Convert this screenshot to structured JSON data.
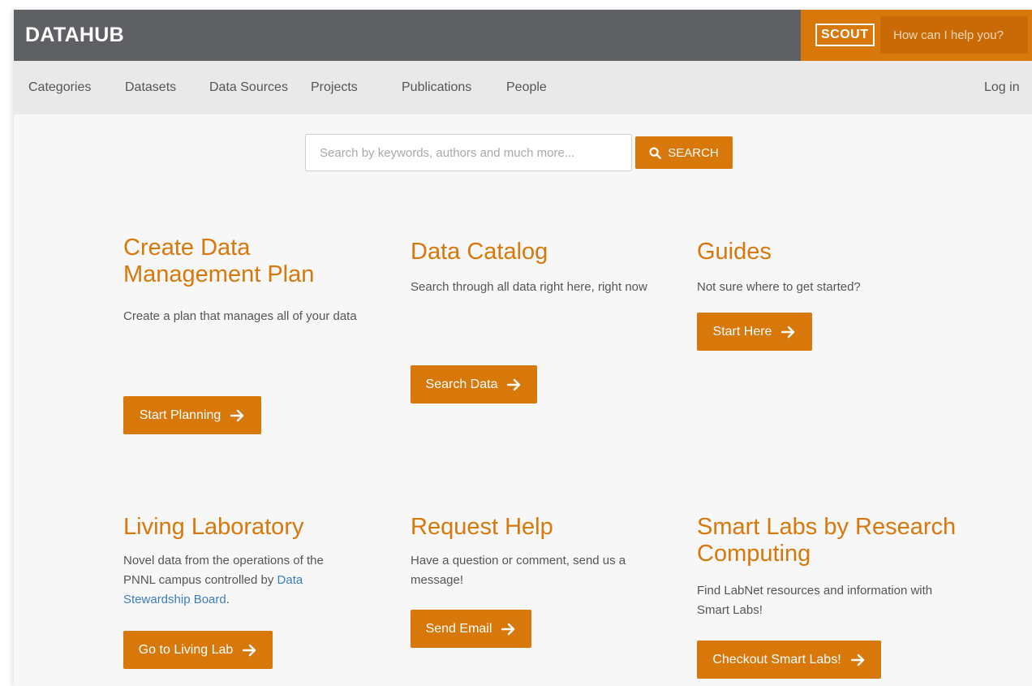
{
  "header": {
    "logo": "DATAHUB",
    "scout_logo": "SCOUT",
    "help_placeholder": "How can I help you?"
  },
  "nav": {
    "items": [
      "Categories",
      "Datasets",
      "Data Sources",
      "Projects",
      "Publications",
      "People"
    ],
    "login": "Log in"
  },
  "search": {
    "placeholder": "Search by keywords, authors and much more...",
    "button_label": "SEARCH"
  },
  "cards": [
    {
      "title": "Create Data Management Plan",
      "description": "Create a plan that manages all of your data",
      "button": "Start Planning"
    },
    {
      "title": "Data Catalog",
      "description": "Search through all data right here, right now",
      "button": "Search Data"
    },
    {
      "title": "Guides",
      "description": "Not sure where to get started?",
      "button": "Start Here"
    },
    {
      "title": "Living Laboratory",
      "description_prefix": "Novel data from the operations of the PNNL campus controlled by",
      "description_link": "Data Stewardship Board",
      "description_suffix": ".",
      "button": "Go to Living Lab"
    },
    {
      "title": "Request Help",
      "description": "Have a question or comment, send us a message!",
      "button": "Send Email"
    },
    {
      "title": "Smart Labs by Research Computing",
      "description": "Find LabNet resources and information with Smart Labs!",
      "button": "Checkout Smart Labs!"
    }
  ],
  "colors": {
    "header_bg": "#5f6063",
    "accent": "#d8770a",
    "nav_bg": "#e9e9e9",
    "link": "#3a7fbf"
  },
  "icons": {
    "search": "magnifier-icon",
    "button_arrow": "arrow-right-icon"
  }
}
